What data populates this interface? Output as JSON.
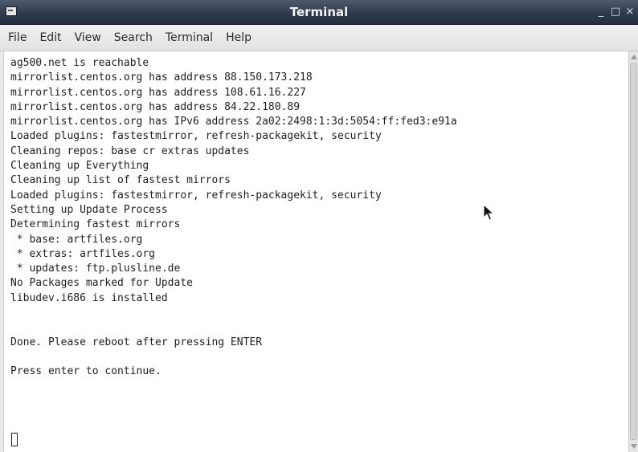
{
  "window": {
    "title": "Terminal",
    "controls": {
      "minimize": "_",
      "maximize": "□",
      "close": "×"
    }
  },
  "menubar": {
    "items": [
      "File",
      "Edit",
      "View",
      "Search",
      "Terminal",
      "Help"
    ]
  },
  "terminal": {
    "lines": [
      "ag500.net is reachable",
      "mirrorlist.centos.org has address 88.150.173.218",
      "mirrorlist.centos.org has address 108.61.16.227",
      "mirrorlist.centos.org has address 84.22.180.89",
      "mirrorlist.centos.org has IPv6 address 2a02:2498:1:3d:5054:ff:fed3:e91a",
      "Loaded plugins: fastestmirror, refresh-packagekit, security",
      "Cleaning repos: base cr extras updates",
      "Cleaning up Everything",
      "Cleaning up list of fastest mirrors",
      "Loaded plugins: fastestmirror, refresh-packagekit, security",
      "Setting up Update Process",
      "Determining fastest mirrors",
      " * base: artfiles.org",
      " * extras: artfiles.org",
      " * updates: ftp.plusline.de",
      "No Packages marked for Update",
      "libudev.i686 is installed",
      "",
      "",
      "Done. Please reboot after pressing ENTER",
      "",
      "Press enter to continue.",
      ""
    ]
  },
  "icons": {
    "app": "terminal-app-icon",
    "cursor": "text-cursor-block",
    "pointer": "mouse-pointer-icon"
  }
}
